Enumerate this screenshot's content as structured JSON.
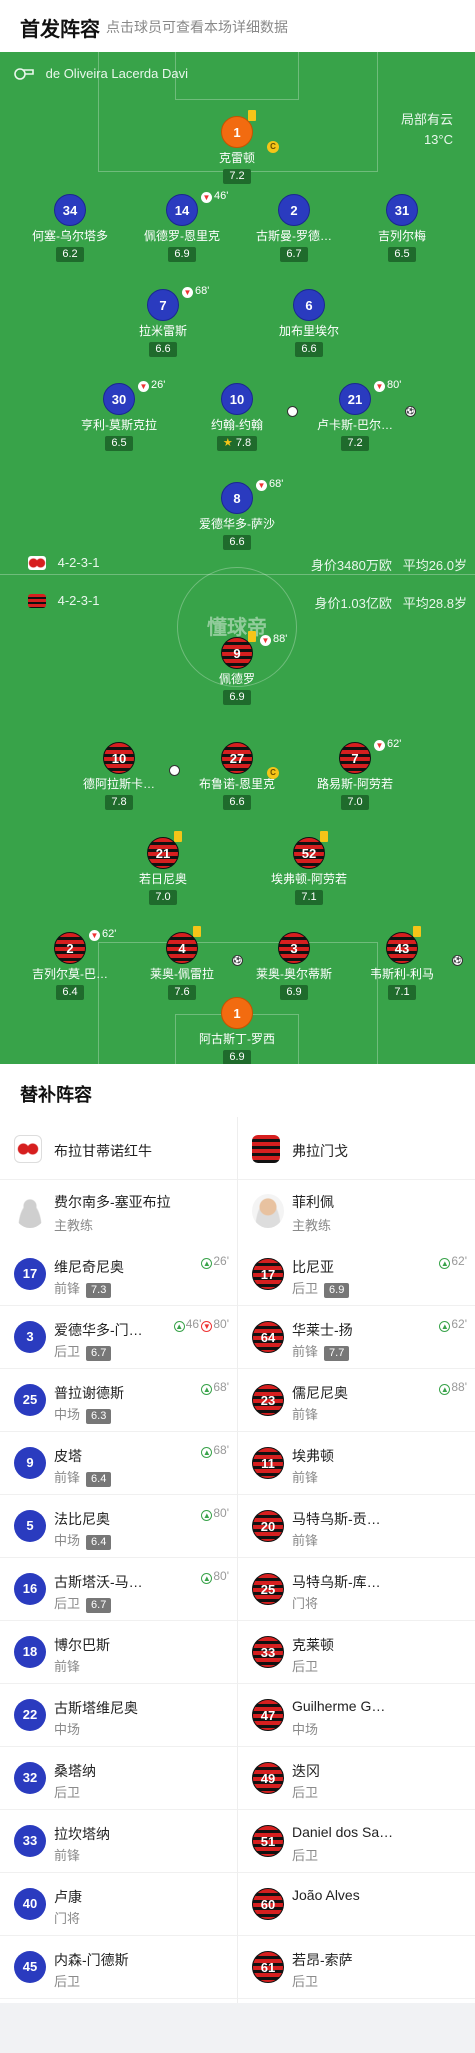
{
  "header": {
    "title": "首发阵容",
    "subtitle": "点击球员可查看本场详细数据"
  },
  "referee": {
    "name": "de Oliveira Lacerda Davi"
  },
  "weather": {
    "condition": "局部有云",
    "temp": "13°C"
  },
  "home": {
    "formation": "4-2-3-1",
    "value": "身价3480万欧",
    "age": "平均26.0岁"
  },
  "away": {
    "formation": "4-2-3-1",
    "value": "身价1.03亿欧",
    "age": "平均28.8岁"
  },
  "watermark": "懂球帝",
  "pitch_home": [
    {
      "num": "1",
      "name": "克雷顿",
      "rating": "7.2",
      "gk": true,
      "captain": true,
      "card": true
    },
    {
      "num": "34",
      "name": "何塞-乌尔塔多",
      "rating": "6.2"
    },
    {
      "num": "14",
      "name": "佩德罗-恩里克",
      "rating": "6.9",
      "subOut": "46'"
    },
    {
      "num": "2",
      "name": "古斯曼-罗德…",
      "rating": "6.7"
    },
    {
      "num": "31",
      "name": "吉列尔梅",
      "rating": "6.5"
    },
    {
      "num": "7",
      "name": "拉米雷斯",
      "rating": "6.6",
      "subOut": "68'"
    },
    {
      "num": "6",
      "name": "加布里埃尔",
      "rating": "6.6"
    },
    {
      "num": "30",
      "name": "亨利-莫斯克拉",
      "rating": "6.5",
      "subOut": "26'"
    },
    {
      "num": "10",
      "name": "约翰-约翰",
      "rating": "7.8",
      "star": true,
      "assist": true
    },
    {
      "num": "21",
      "name": "卢卡斯-巴尔…",
      "rating": "7.2",
      "subOut": "80'",
      "goal": true
    },
    {
      "num": "8",
      "name": "爱德华多-萨沙",
      "rating": "6.6",
      "subOut": "68'"
    }
  ],
  "pitch_away": [
    {
      "num": "9",
      "name": "佩德罗",
      "rating": "6.9",
      "subOut": "88'",
      "card": true
    },
    {
      "num": "10",
      "name": "德阿拉斯卡…",
      "rating": "7.8",
      "assist": true
    },
    {
      "num": "27",
      "name": "布鲁诺-恩里克",
      "rating": "6.6",
      "captain": true
    },
    {
      "num": "7",
      "name": "路易斯-阿劳若",
      "rating": "7.0",
      "subOut": "62'"
    },
    {
      "num": "21",
      "name": "若日尼奥",
      "rating": "7.0",
      "card": true
    },
    {
      "num": "52",
      "name": "埃弗顿-阿劳若",
      "rating": "7.1",
      "card": true
    },
    {
      "num": "2",
      "name": "吉列尔莫-巴…",
      "rating": "6.4",
      "subOut": "62'"
    },
    {
      "num": "4",
      "name": "莱奥-佩雷拉",
      "rating": "7.6",
      "card": true,
      "goal": true
    },
    {
      "num": "3",
      "name": "莱奥-奥尔蒂斯",
      "rating": "6.9"
    },
    {
      "num": "43",
      "name": "韦斯利-利马",
      "rating": "7.1",
      "card": true,
      "goal": true
    },
    {
      "num": "1",
      "name": "阿古斯丁-罗西",
      "rating": "6.9",
      "gk": true
    }
  ],
  "subs": {
    "title": "替补阵容",
    "home_team": "布拉甘蒂诺红牛",
    "away_team": "弗拉门戈",
    "home_coach": {
      "name": "费尔南多-塞亚布拉",
      "role": "主教练"
    },
    "away_coach": {
      "name": "菲利佩",
      "role": "主教练"
    },
    "home": [
      {
        "num": "17",
        "name": "维尼奇尼奥",
        "pos": "前锋",
        "rating": "7.3",
        "ev": [
          {
            "t": "in",
            "m": "26'"
          }
        ]
      },
      {
        "num": "3",
        "name": "爱德华多-门…",
        "pos": "后卫",
        "rating": "6.7",
        "ev": [
          {
            "t": "in",
            "m": "46'"
          },
          {
            "t": "out",
            "m": "80'"
          }
        ]
      },
      {
        "num": "25",
        "name": "普拉谢德斯",
        "pos": "中场",
        "rating": "6.3",
        "ev": [
          {
            "t": "in",
            "m": "68'"
          }
        ]
      },
      {
        "num": "9",
        "name": "皮塔",
        "pos": "前锋",
        "rating": "6.4",
        "ev": [
          {
            "t": "in",
            "m": "68'"
          }
        ]
      },
      {
        "num": "5",
        "name": "法比尼奥",
        "pos": "中场",
        "rating": "6.4",
        "ev": [
          {
            "t": "in",
            "m": "80'"
          }
        ]
      },
      {
        "num": "16",
        "name": "古斯塔沃-马…",
        "pos": "后卫",
        "rating": "6.7",
        "ev": [
          {
            "t": "in",
            "m": "80'"
          }
        ]
      },
      {
        "num": "18",
        "name": "博尔巴斯",
        "pos": "前锋"
      },
      {
        "num": "22",
        "name": "古斯塔维尼奥",
        "pos": "中场"
      },
      {
        "num": "32",
        "name": "桑塔纳",
        "pos": "后卫"
      },
      {
        "num": "33",
        "name": "拉坎塔纳",
        "pos": "前锋"
      },
      {
        "num": "40",
        "name": "卢康",
        "pos": "门将"
      },
      {
        "num": "45",
        "name": "内森-门德斯",
        "pos": "后卫"
      }
    ],
    "away": [
      {
        "num": "17",
        "name": "比尼亚",
        "pos": "后卫",
        "rating": "6.9",
        "ev": [
          {
            "t": "in",
            "m": "62'"
          }
        ]
      },
      {
        "num": "64",
        "name": "华莱士-扬",
        "pos": "前锋",
        "rating": "7.7",
        "ev": [
          {
            "t": "in",
            "m": "62'"
          }
        ]
      },
      {
        "num": "23",
        "name": "儒尼尼奥",
        "pos": "前锋",
        "ev": [
          {
            "t": "in",
            "m": "88'"
          }
        ]
      },
      {
        "num": "11",
        "name": "埃弗顿",
        "pos": "前锋"
      },
      {
        "num": "20",
        "name": "马特乌斯-贡…",
        "pos": "前锋"
      },
      {
        "num": "25",
        "name": "马特乌斯-库…",
        "pos": "门将"
      },
      {
        "num": "33",
        "name": "克莱顿",
        "pos": "后卫"
      },
      {
        "num": "47",
        "name": "Guilherme G…",
        "pos": "中场"
      },
      {
        "num": "49",
        "name": "迭冈",
        "pos": "后卫"
      },
      {
        "num": "51",
        "name": "Daniel dos Sa…",
        "pos": "后卫"
      },
      {
        "num": "60",
        "name": "João Alves",
        "pos": ""
      },
      {
        "num": "61",
        "name": "若昂-索萨",
        "pos": "后卫"
      }
    ]
  },
  "colors": {
    "pitch": "#38a349",
    "home": "#2a3bbf",
    "away": "#d61f1f",
    "gk": "#f26b10"
  }
}
